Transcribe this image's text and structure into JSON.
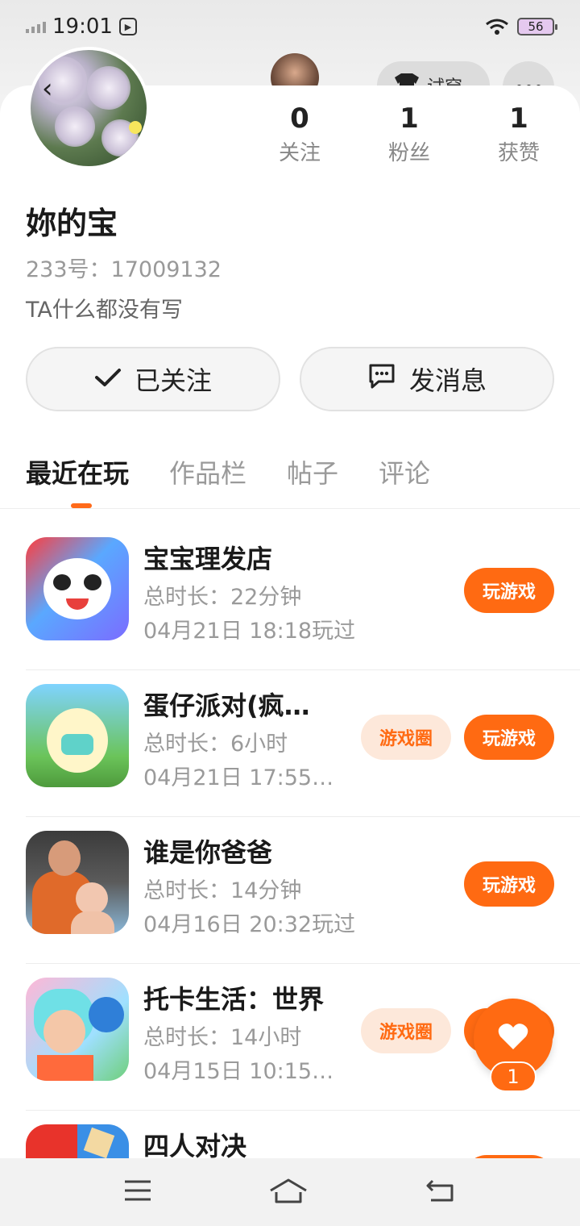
{
  "status_bar": {
    "time": "19:01",
    "battery": "56"
  },
  "header": {
    "watch_label": "试穿"
  },
  "profile": {
    "nickname": "妳的宝",
    "user_id": "233号：17009132",
    "bio": "TA什么都没有写"
  },
  "stats": [
    {
      "value": "0",
      "label": "关注"
    },
    {
      "value": "1",
      "label": "粉丝"
    },
    {
      "value": "1",
      "label": "获赞"
    }
  ],
  "actions": {
    "follow_label": "已关注",
    "message_label": "发消息"
  },
  "tabs": [
    {
      "label": "最近在玩",
      "active": true
    },
    {
      "label": "作品栏",
      "active": false
    },
    {
      "label": "帖子",
      "active": false
    },
    {
      "label": "评论",
      "active": false
    }
  ],
  "games": [
    {
      "title": "宝宝理发店",
      "duration": "总时长：22分钟",
      "last_played": "04月21日 18:18玩过",
      "has_circle": false
    },
    {
      "title": "蛋仔派对(疯…",
      "duration": "总时长：6小时",
      "last_played": "04月21日 17:55…",
      "has_circle": true
    },
    {
      "title": "谁是你爸爸",
      "duration": "总时长：14分钟",
      "last_played": "04月16日 20:32玩过",
      "has_circle": false
    },
    {
      "title": "托卡生活：世界",
      "duration": "总时长：14小时",
      "last_played": "04月15日 10:15…",
      "has_circle": true
    },
    {
      "title": "四人对决",
      "duration": "",
      "last_played": "",
      "has_circle": false
    }
  ],
  "buttons": {
    "play_label": "玩游戏",
    "circle_label": "游戏圈"
  },
  "like_fab": {
    "count": "1"
  },
  "colors": {
    "accent": "#ff6a12",
    "circle_bg": "#fde8da"
  }
}
